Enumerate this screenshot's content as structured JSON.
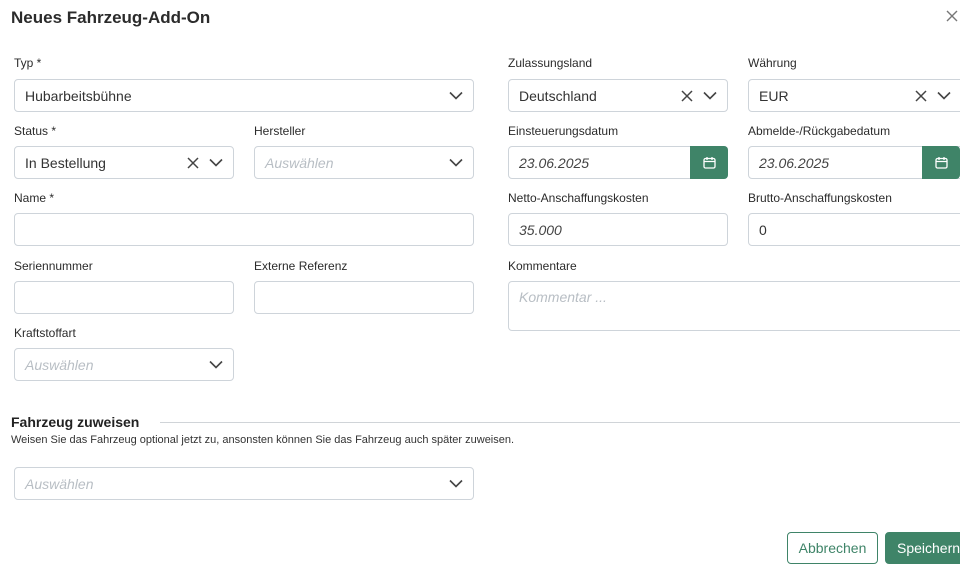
{
  "dialog": {
    "title": "Neues Fahrzeug-Add-On"
  },
  "fields": {
    "typ": {
      "label": "Typ *",
      "value": "Hubarbeitsbühne"
    },
    "zulassungsland": {
      "label": "Zulassungsland",
      "value": "Deutschland"
    },
    "waehrung": {
      "label": "Währung",
      "value": "EUR"
    },
    "status": {
      "label": "Status *",
      "value": "In Bestellung"
    },
    "hersteller": {
      "label": "Hersteller",
      "placeholder": "Auswählen"
    },
    "einsteuerungsdatum": {
      "label": "Einsteuerungsdatum",
      "value": "23.06.2025"
    },
    "abmeldedatum": {
      "label": "Abmelde-/Rückgabedatum",
      "value": "23.06.2025"
    },
    "name": {
      "label": "Name *",
      "value": ""
    },
    "netto": {
      "label": "Netto-Anschaffungskosten",
      "value": "35.000"
    },
    "brutto": {
      "label": "Brutto-Anschaffungskosten",
      "value": "0"
    },
    "seriennummer": {
      "label": "Seriennummer",
      "value": ""
    },
    "externe_referenz": {
      "label": "Externe Referenz",
      "value": ""
    },
    "kommentare": {
      "label": "Kommentare",
      "placeholder": "Kommentar ..."
    },
    "kraftstoffart": {
      "label": "Kraftstoffart",
      "placeholder": "Auswählen"
    }
  },
  "assign": {
    "title": "Fahrzeug zuweisen",
    "subtitle": "Weisen Sie das Fahrzeug optional jetzt zu, ansonsten können Sie das Fahrzeug auch später zuweisen.",
    "placeholder": "Auswählen"
  },
  "actions": {
    "cancel": "Abbrechen",
    "save": "Speichern"
  },
  "colors": {
    "accent": "#3f8468",
    "border": "#ced4da"
  }
}
